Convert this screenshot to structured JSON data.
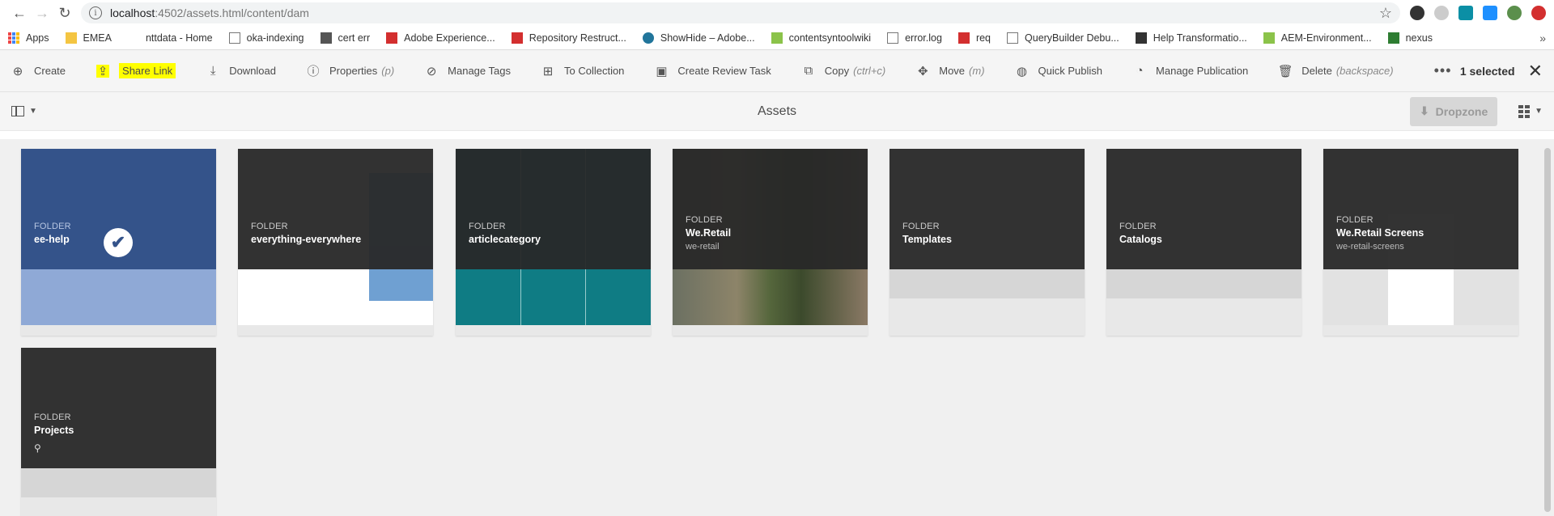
{
  "browser": {
    "url_host": "localhost",
    "url_path": ":4502/assets.html/content/dam",
    "bookmarks": [
      {
        "label": "Apps",
        "icon": "apps-grid-icon"
      },
      {
        "label": "EMEA",
        "icon": "folder-icon"
      },
      {
        "label": "nttdata - Home",
        "icon": "blank-icon"
      },
      {
        "label": "oka-indexing",
        "icon": "page-icon"
      },
      {
        "label": "cert err",
        "icon": "list-icon"
      },
      {
        "label": "Adobe Experience...",
        "icon": "adobe-icon"
      },
      {
        "label": "Repository Restruct...",
        "icon": "adobe-icon"
      },
      {
        "label": "ShowHide – Adobe...",
        "icon": "wordpress-icon"
      },
      {
        "label": "contentsyntoolwiki",
        "icon": "confluence-icon"
      },
      {
        "label": "error.log",
        "icon": "page-icon"
      },
      {
        "label": "req",
        "icon": "adobe-icon"
      },
      {
        "label": "QueryBuilder Debu...",
        "icon": "page-icon"
      },
      {
        "label": "Help Transformatio...",
        "icon": "tool-icon"
      },
      {
        "label": "AEM-Environment...",
        "icon": "confluence-icon"
      },
      {
        "label": "nexus",
        "icon": "nexus-icon"
      }
    ],
    "more": "»"
  },
  "actionbar": {
    "actions": [
      {
        "label": "Create",
        "hint": "",
        "icon": "plus-circle-icon"
      },
      {
        "label": "Share Link",
        "hint": "",
        "icon": "share-icon"
      },
      {
        "label": "Download",
        "hint": "",
        "icon": "download-icon"
      },
      {
        "label": "Properties",
        "hint": "(p)",
        "icon": "info-icon"
      },
      {
        "label": "Manage Tags",
        "hint": "",
        "icon": "tag-icon"
      },
      {
        "label": "To Collection",
        "hint": "",
        "icon": "collection-icon"
      },
      {
        "label": "Create Review Task",
        "hint": "",
        "icon": "review-task-icon"
      },
      {
        "label": "Copy",
        "hint": "(ctrl+c)",
        "icon": "copy-icon"
      },
      {
        "label": "Move",
        "hint": "(m)",
        "icon": "move-icon"
      },
      {
        "label": "Quick Publish",
        "hint": "",
        "icon": "globe-icon"
      },
      {
        "label": "Manage Publication",
        "hint": "",
        "icon": "globe-clock-icon"
      },
      {
        "label": "Delete",
        "hint": "(backspace)",
        "icon": "trash-icon"
      }
    ],
    "more": "•••",
    "selected_count": "1 selected",
    "close": "✕"
  },
  "titlebar": {
    "title": "Assets",
    "dropzone": "Dropzone"
  },
  "cards": [
    {
      "kind": "FOLDER",
      "name": "ee-help",
      "sub": "",
      "selected": true
    },
    {
      "kind": "FOLDER",
      "name": "everything-everywhere",
      "sub": "",
      "selected": false
    },
    {
      "kind": "FOLDER",
      "name": "articlecategory",
      "sub": "",
      "selected": false
    },
    {
      "kind": "FOLDER",
      "name": "We.Retail",
      "sub": "we-retail",
      "selected": false
    },
    {
      "kind": "FOLDER",
      "name": "Templates",
      "sub": "",
      "selected": false
    },
    {
      "kind": "FOLDER",
      "name": "Catalogs",
      "sub": "",
      "selected": false
    },
    {
      "kind": "FOLDER",
      "name": "We.Retail Screens",
      "sub": "we-retail-screens",
      "selected": false
    },
    {
      "kind": "FOLDER",
      "name": "Projects",
      "sub": "",
      "selected": false
    }
  ],
  "colors": {
    "highlight": "#ffff00",
    "selected_card": "#34538a",
    "selected_card_light": "#8fa9d6",
    "card_overlay": "#2d2d2d",
    "teal": "#0f7c84"
  }
}
